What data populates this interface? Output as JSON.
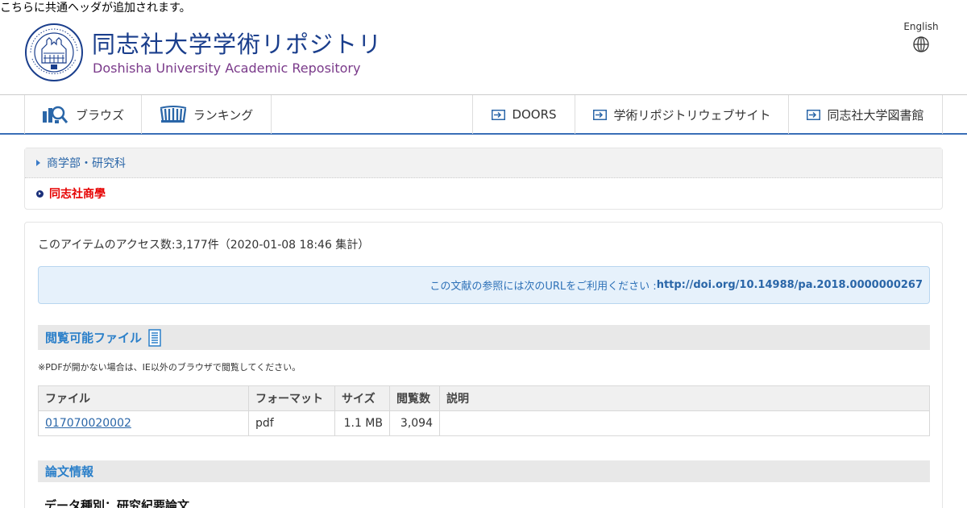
{
  "common_header_note": "こちらに共通ヘッダが追加されます。",
  "site": {
    "title_ja": "同志社大学学術リポジトリ",
    "title_en": "Doshisha University Academic Repository",
    "seal_texts": [
      "DOSHISHA UNIVERSITY",
      "MDCCCLXXV",
      "KYOTO",
      "VERITAS"
    ],
    "language_link": "English"
  },
  "nav": {
    "browse": "ブラウズ",
    "ranking": "ランキング",
    "doors": "DOORS",
    "repo_site": "学術リポジトリウェブサイト",
    "library": "同志社大学図書館"
  },
  "breadcrumb": {
    "parent": "商学部・研究科",
    "current": "同志社商學"
  },
  "item": {
    "access_count_text": "このアイテムのアクセス数:3,177件（2020-01-08 18:46 集計）",
    "doi_prefix": "この文献の参照には次のURLをご利用ください : ",
    "doi_url": "http://doi.org/10.14988/pa.2018.0000000267",
    "files_heading": "閲覧可能ファイル",
    "pdf_note": "※PDFが開かない場合は、IE以外のブラウザで閲覧してください。",
    "table_headers": [
      "ファイル",
      "フォーマット",
      "サイズ",
      "閲覧数",
      "説明"
    ],
    "files": [
      {
        "name": "017070020002",
        "format": "pdf",
        "size": "1.1 MB",
        "views": "3,094",
        "description": ""
      }
    ],
    "paper_info_heading": "論文情報",
    "data_type": "データ種別：研究紀要論文"
  },
  "colors": {
    "brand_blue": "#1a3e8c",
    "brand_purple": "#7a3a8a",
    "link_blue": "#2a66a8",
    "accent_red": "#e60000",
    "nav_border": "#3a6fb7"
  }
}
